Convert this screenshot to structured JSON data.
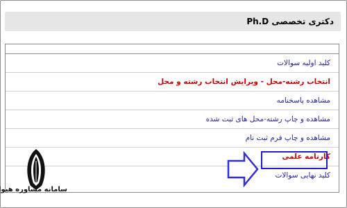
{
  "header": {
    "title": "دکتری تخصصی Ph.D"
  },
  "menu": {
    "items": [
      {
        "label": "کلید اولیه سوالات"
      },
      {
        "label": "انتخاب رشته-محل - ویرایش انتخاب رشته و محل"
      },
      {
        "label": "مشاهده پاسخنامه"
      },
      {
        "label": "مشاهده و چاپ رشته-محل های ثبت شده"
      },
      {
        "label": "مشاهده و چاپ فرم ثبت نام"
      },
      {
        "label": "کارنامه علمی"
      },
      {
        "label": "کلید نهایی سوالات"
      }
    ]
  },
  "watermark": {
    "text": "سامانه مشاوره هیوا",
    "icon": "feather-logo-icon"
  },
  "colors": {
    "link": "#1f1fb0",
    "link_emphasis": "#d40000",
    "header_bg": "#e6e6e6",
    "arrow": "#2f2fd8"
  }
}
